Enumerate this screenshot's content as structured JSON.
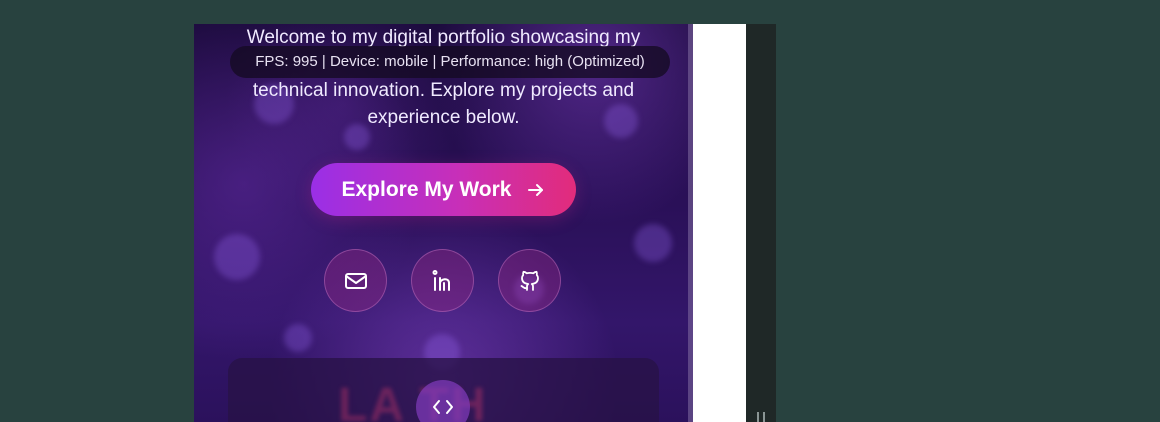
{
  "hero": {
    "line1": "Welcome to my digital portfolio showcasing my",
    "line2": "technical innovation. Explore my projects and",
    "line3": "experience below."
  },
  "perf_badge": "FPS: 995 | Device: mobile | Performance: high (Optimized)",
  "cta": {
    "label": "Explore My Work",
    "icon": "arrow-right-icon"
  },
  "social": [
    {
      "name": "email",
      "icon": "mail-icon"
    },
    {
      "name": "linkedin",
      "icon": "linkedin-icon"
    },
    {
      "name": "github",
      "icon": "github-icon"
    }
  ],
  "card": {
    "ghost_text": "LA  TH",
    "icon": "code-icon"
  },
  "colors": {
    "page_bg": "#28423f",
    "cta_start": "#9a2fe6",
    "cta_end": "#e22c7b",
    "hero_text": "#f0eaff"
  }
}
